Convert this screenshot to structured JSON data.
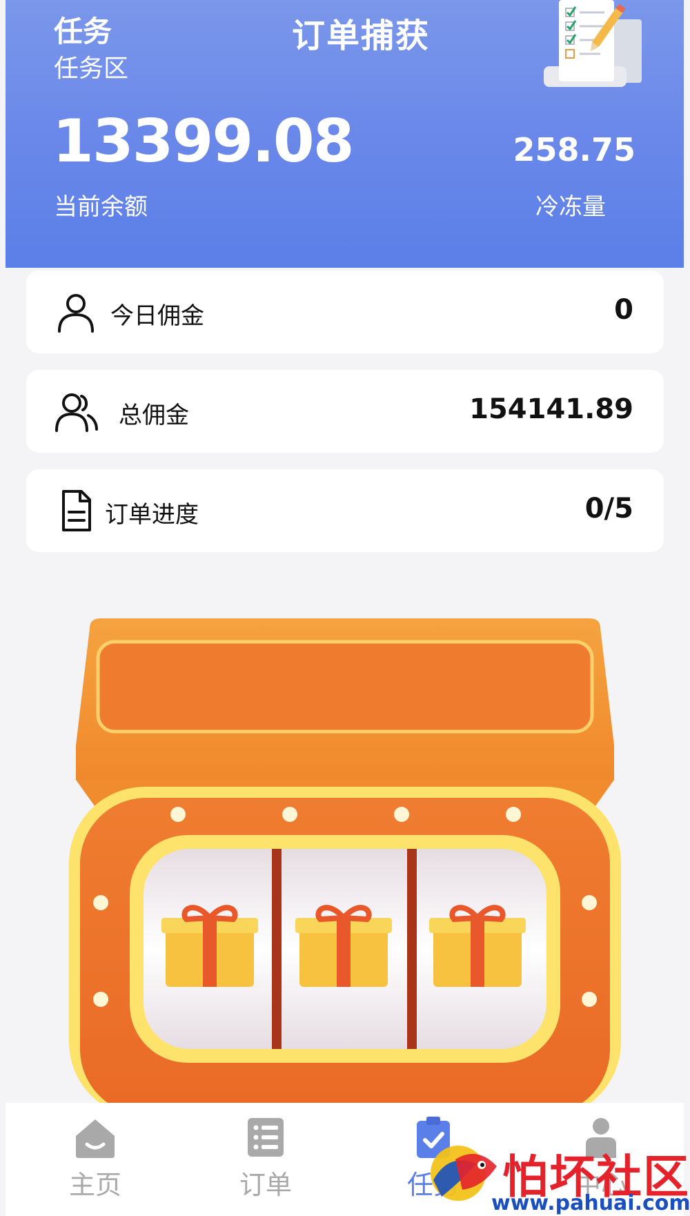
{
  "header": {
    "section": "任务",
    "subsection": "任务区",
    "title": "订单捕获",
    "balance": "13399.08",
    "balance_label": "当前余额",
    "frozen": "258.75",
    "frozen_label": "冷冻量"
  },
  "cards": [
    {
      "label": "今日佣金",
      "value": "0",
      "icon": "user-icon"
    },
    {
      "label": "总佣金",
      "value": "154141.89",
      "icon": "users-icon"
    },
    {
      "label": "订单进度",
      "value": "0/5",
      "icon": "document-icon"
    }
  ],
  "nav": {
    "items": [
      {
        "label": "主页",
        "icon": "home-icon"
      },
      {
        "label": "订单",
        "icon": "list-icon"
      },
      {
        "label": "任务",
        "icon": "clipboard-check-icon"
      },
      {
        "label": "中心",
        "icon": "person-icon"
      }
    ],
    "active": "任务"
  },
  "watermark": {
    "text": "怕坏社区",
    "url": "www.pahuai.com"
  },
  "colors": {
    "header_gradient_top": "#7b97ea",
    "header_gradient_bottom": "#5b7fe8",
    "accent": "#5b7fe8",
    "slot_orange": "#ee7a2f",
    "slot_yellow": "#fde36b",
    "nav_inactive": "#a9a9a9",
    "watermark_red": "#e4222b"
  }
}
